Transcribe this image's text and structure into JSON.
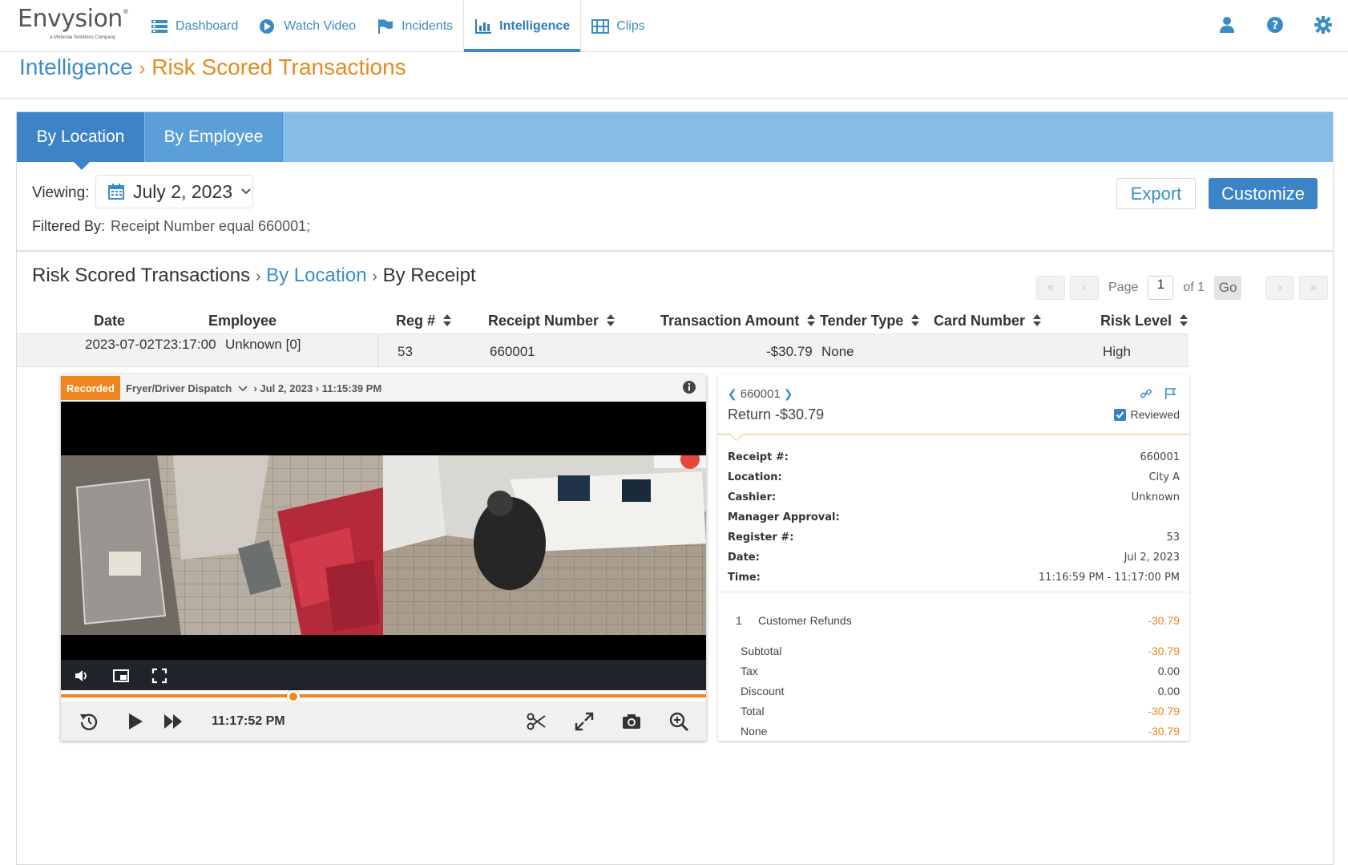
{
  "brand": {
    "name": "Envysion",
    "tagline": "a Motorola Solutions Company"
  },
  "nav": {
    "items": [
      {
        "label": "Dashboard",
        "icon": "dashboard-icon"
      },
      {
        "label": "Watch Video",
        "icon": "play-circle-icon"
      },
      {
        "label": "Incidents",
        "icon": "flag-icon"
      },
      {
        "label": "Intelligence",
        "icon": "bar-chart-icon",
        "active": true
      },
      {
        "label": "Clips",
        "icon": "film-icon"
      }
    ],
    "right_icons": [
      "user-icon",
      "help-icon",
      "gear-icon"
    ]
  },
  "breadcrumb": {
    "root": "Intelligence",
    "separator": "›",
    "current": "Risk Scored Transactions"
  },
  "tabs": [
    {
      "label": "By Location",
      "active": true
    },
    {
      "label": "By Employee",
      "active": false
    }
  ],
  "filters": {
    "viewing_label": "Viewing:",
    "date": "July 2, 2023",
    "filtered_by_label": "Filtered By:",
    "filtered_by_value": "Receipt Number equal 660001;"
  },
  "actions": {
    "export": "Export",
    "customize": "Customize"
  },
  "sub_breadcrumb": {
    "root": "Risk Scored Transactions",
    "link": "By Location",
    "current": "By Receipt",
    "separator": "›"
  },
  "pager": {
    "first": "«",
    "prev": "‹",
    "page_label": "Page",
    "page": "1",
    "of_label": "of 1",
    "go": "Go",
    "next": "›",
    "last": "»"
  },
  "table": {
    "columns": [
      "Date",
      "Employee",
      "Reg #",
      "Receipt Number",
      "Transaction Amount",
      "Tender Type",
      "Card Number",
      "Risk Level"
    ],
    "row": {
      "date": "2023-07-02T23:17:00",
      "employee": "Unknown [0]",
      "reg": "53",
      "receipt": "660001",
      "amount": "-$30.79",
      "tender": "None",
      "card": "",
      "risk": "High"
    }
  },
  "video": {
    "badge": "Recorded",
    "camera": "Fryer/Driver Dispatch",
    "timestamp": "› Jul 2, 2023 › 11:15:39 PM",
    "current_time": "11:17:52 PM",
    "progress": 0.36,
    "accent": "#f0861f"
  },
  "receipt": {
    "number": "660001",
    "title": "Return -$30.79",
    "reviewed_label": "Reviewed",
    "reviewed": true,
    "fields": [
      {
        "key": "Receipt #:",
        "value": "660001"
      },
      {
        "key": "Location:",
        "value": "City A"
      },
      {
        "key": "Cashier:",
        "value": "Unknown"
      },
      {
        "key": "Manager Approval:",
        "value": ""
      },
      {
        "key": "Register #:",
        "value": "53"
      },
      {
        "key": "Date:",
        "value": "Jul 2, 2023"
      },
      {
        "key": "Time:",
        "value": "11:16:59 PM - 11:17:00 PM"
      }
    ],
    "line_items": [
      {
        "qty": "1",
        "label": "Customer Refunds",
        "amount": "-30.79"
      }
    ],
    "summary": [
      {
        "label": "Subtotal",
        "amount": "-30.79",
        "highlight": true
      },
      {
        "label": "Tax",
        "amount": "0.00",
        "highlight": false
      },
      {
        "label": "Discount",
        "amount": "0.00",
        "highlight": false
      },
      {
        "label": "Total",
        "amount": "-30.79",
        "highlight": true
      },
      {
        "label": "None",
        "amount": "-30.79",
        "highlight": true
      }
    ]
  },
  "colors": {
    "primary": "#3d84c6",
    "link": "#3b8cc6",
    "accent": "#f0861f",
    "tabbar": "#85bde6"
  }
}
